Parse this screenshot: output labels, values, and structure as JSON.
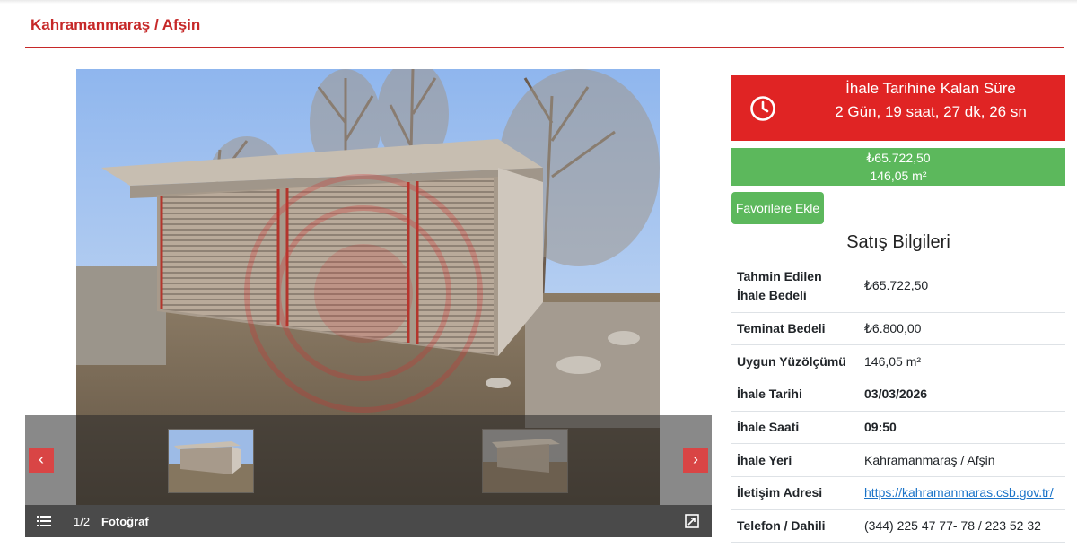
{
  "header": {
    "title": "Kahramanmaraş / Afşin"
  },
  "gallery": {
    "counter": "1/2",
    "label": "Fotoğraf",
    "icons": {
      "list": "list-icon",
      "expand": "expand-icon",
      "prev": "chevron-left-icon",
      "next": "chevron-right-icon"
    }
  },
  "timer": {
    "title": "İhale Tarihine Kalan Süre",
    "value": "2 Gün, 19 saat, 27 dk, 26 sn",
    "icon": "clock-icon",
    "color": "#e02424"
  },
  "price": {
    "amount": "₺65.722,50",
    "area": "146,05 m²",
    "color": "#5cb85c"
  },
  "favorite_button": {
    "label": "Favorilere Ekle"
  },
  "sales": {
    "heading": "Satış Bilgileri",
    "rows": [
      {
        "key": "Tahmin Edilen İhale Bedeli",
        "value": "₺65.722,50"
      },
      {
        "key": "Teminat Bedeli",
        "value": "₺6.800,00"
      },
      {
        "key": "Uygun Yüzölçümü",
        "value": "146,05 m²"
      },
      {
        "key": "İhale Tarihi",
        "value": "03/03/2026"
      },
      {
        "key": "İhale Saati",
        "value": "09:50"
      },
      {
        "key": "İhale Yeri",
        "value": "Kahramanmaraş / Afşin"
      },
      {
        "key": "İletişim Adresi",
        "value": "https://kahramanmaras.csb.gov.tr/"
      },
      {
        "key": "Telefon / Dahili",
        "value": "(344) 225 47 77- 78 / 223 52 32"
      }
    ]
  }
}
